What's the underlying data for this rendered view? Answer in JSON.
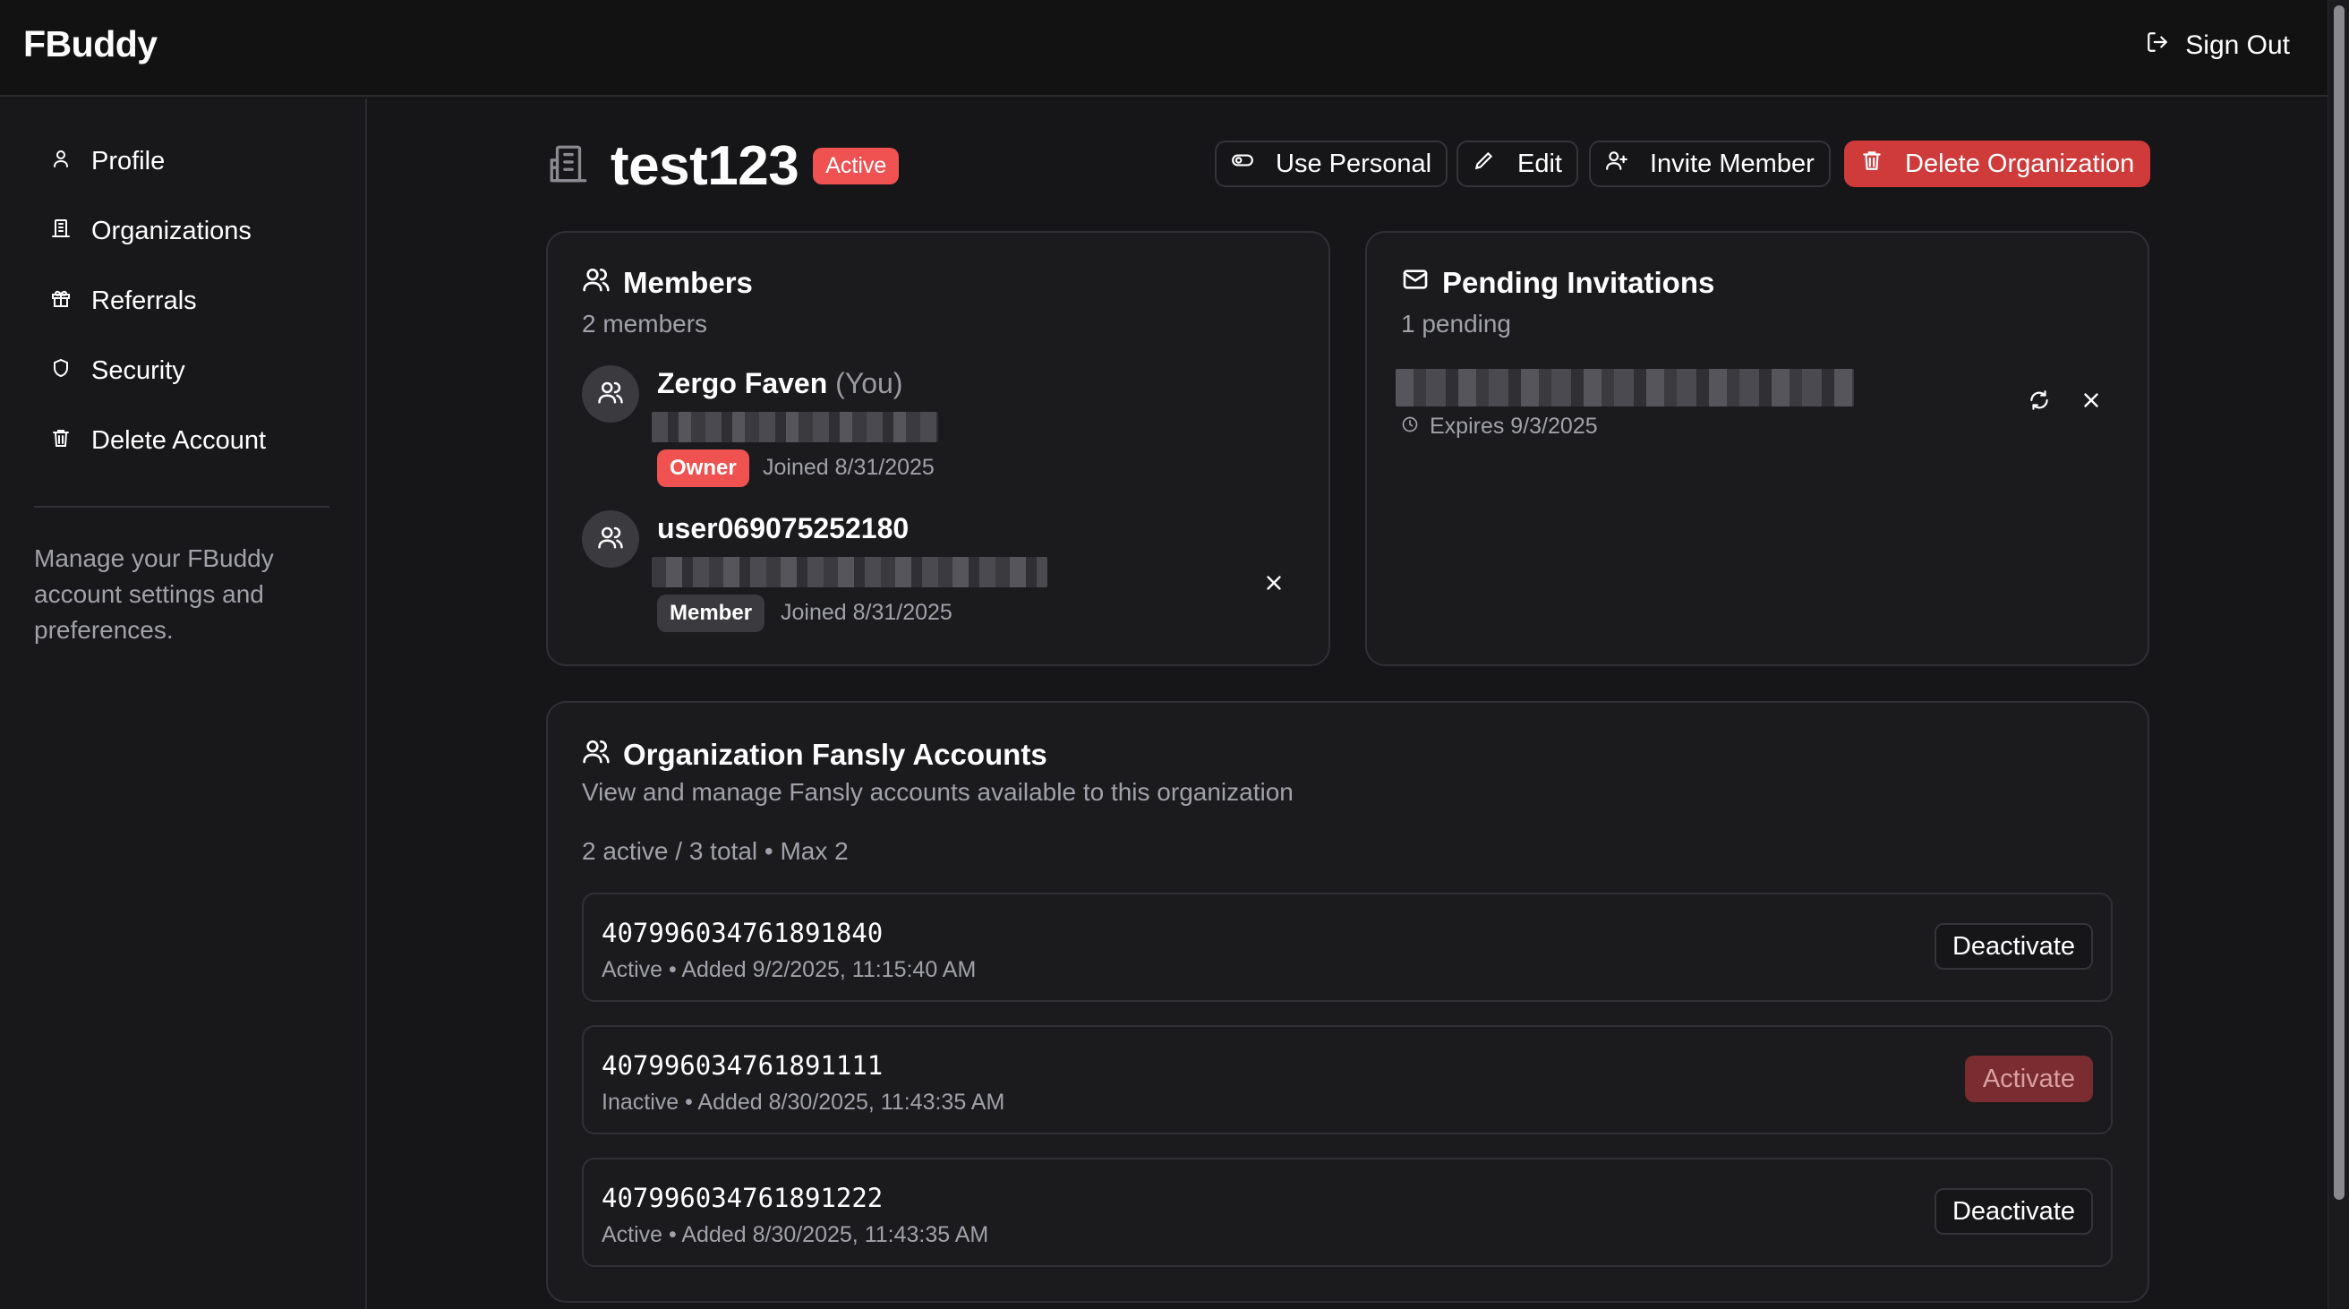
{
  "header": {
    "brand": "FBuddy",
    "sign_out": "Sign Out"
  },
  "sidebar": {
    "items": [
      {
        "label": "Profile",
        "icon": "user-icon"
      },
      {
        "label": "Organizations",
        "icon": "building-icon"
      },
      {
        "label": "Referrals",
        "icon": "gift-icon"
      },
      {
        "label": "Security",
        "icon": "shield-icon"
      },
      {
        "label": "Delete Account",
        "icon": "trash-icon"
      }
    ],
    "note": "Manage your FBuddy account settings and preferences."
  },
  "org": {
    "name": "test123",
    "status": "Active",
    "actions": {
      "use_personal": "Use Personal",
      "edit": "Edit",
      "invite": "Invite Member",
      "delete": "Delete Organization"
    }
  },
  "members": {
    "title": "Members",
    "count": "2 members",
    "list": [
      {
        "name": "Zergo Faven",
        "you": "(You)",
        "role": "Owner",
        "joined": "Joined 8/31/2025"
      },
      {
        "name": "user069075252180",
        "role": "Member",
        "joined": "Joined 8/31/2025"
      }
    ]
  },
  "invitations": {
    "title": "Pending Invitations",
    "count": "1 pending",
    "items": [
      {
        "expires": "Expires 9/3/2025"
      }
    ]
  },
  "accounts": {
    "title": "Organization Fansly Accounts",
    "subtitle": "View and manage Fansly accounts available to this organization",
    "summary": "2 active / 3 total • Max 2",
    "list": [
      {
        "id": "407996034761891840",
        "meta": "Active • Added 9/2/2025, 11:15:40 AM",
        "action": "Deactivate"
      },
      {
        "id": "407996034761891111",
        "meta": "Inactive • Added 8/30/2025, 11:43:35 AM",
        "action": "Activate"
      },
      {
        "id": "407996034761891222",
        "meta": "Active • Added 8/30/2025, 11:43:35 AM",
        "action": "Deactivate"
      }
    ]
  },
  "colors": {
    "accent_red": "#f05252",
    "danger": "#cf3b3b",
    "background": "#161618"
  }
}
